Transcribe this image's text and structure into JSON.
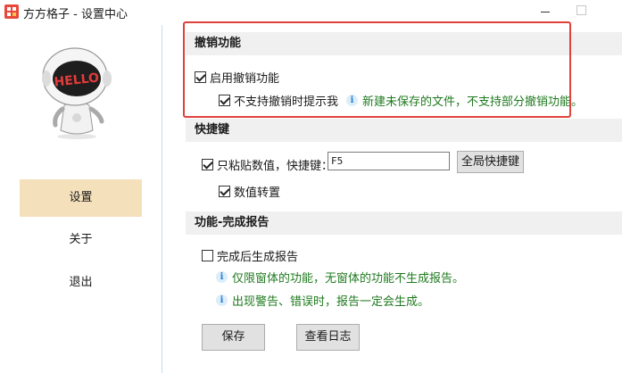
{
  "window": {
    "title": "方方格子 - 设置中心"
  },
  "sidebar": {
    "items": [
      {
        "label": "设置",
        "active": true
      },
      {
        "label": "关于",
        "active": false
      },
      {
        "label": "退出",
        "active": false
      }
    ],
    "mascot_text": "HELLO"
  },
  "undo_section": {
    "header": "撤销功能",
    "enable_undo": {
      "label": "启用撤销功能",
      "checked": true
    },
    "warn_unsupported": {
      "label": "不支持撤销时提示我",
      "checked": true
    },
    "note": "新建未保存的文件，不支持部分撤销功能。"
  },
  "hotkey_section": {
    "header": "快捷键",
    "paste_values": {
      "label": "只粘贴数值，快捷键：",
      "checked": true
    },
    "hotkey_value": "F5",
    "global_hotkey_button": "全局快捷键",
    "transpose": {
      "label": "数值转置",
      "checked": true
    }
  },
  "report_section": {
    "header": "功能-完成报告",
    "generate_report": {
      "label": "完成后生成报告",
      "checked": false
    },
    "note1": "仅限窗体的功能，无窗体的功能不生成报告。",
    "note2": "出现警告、错误时，报告一定会生成。"
  },
  "actions": {
    "save": "保存",
    "view_log": "查看日志"
  },
  "colors": {
    "active_nav": "#f5e0bc",
    "note_text": "#1f7a1f",
    "highlight_border": "#e0413a",
    "info_icon": "#2b7bd1"
  }
}
